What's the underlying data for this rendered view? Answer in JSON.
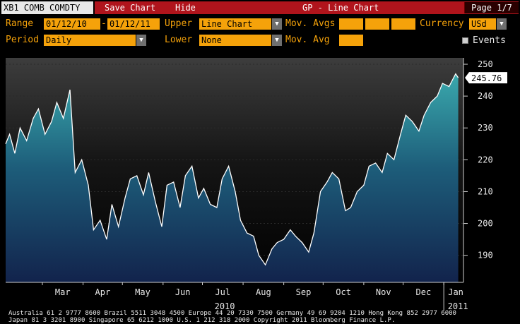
{
  "security": "XB1 COMB COMDTY",
  "toolbar": {
    "save_chart": "Save Chart",
    "hide": "Hide",
    "title": "GP - Line Chart",
    "page": "Page 1/7"
  },
  "controls": {
    "range_label": "Range",
    "range_start": "01/12/10",
    "range_sep": "-",
    "range_end": "01/12/11",
    "upper_label": "Upper",
    "upper_value": "Line Chart",
    "mov_avgs_label": "Mov. Avgs",
    "currency_label": "Currency",
    "currency_value": "USd",
    "period_label": "Period",
    "period_value": "Daily",
    "lower_label": "Lower",
    "lower_value": "None",
    "mov_avg_label": "Mov. Avg",
    "events_label": "Events"
  },
  "colors": {
    "accent": "#f5a20a",
    "bar": "#b0141c",
    "line": "#ffffff"
  },
  "chart_data": {
    "type": "area",
    "title": "",
    "xlabel": "2010",
    "ylabel": "",
    "ylim": [
      181.5,
      252
    ],
    "y_ticks": [
      190,
      200,
      210,
      220,
      230,
      240,
      250
    ],
    "x_month_labels": [
      "Mar",
      "Apr",
      "May",
      "Jun",
      "Jul",
      "Aug",
      "Sep",
      "Oct",
      "Nov",
      "Dec",
      "Jan"
    ],
    "x_year_labels": [
      "2010",
      "2011"
    ],
    "last_value_label": "245.76",
    "series": [
      {
        "x": [
          "2010-02-01",
          "2010-02-04",
          "2010-02-08",
          "2010-02-12",
          "2010-02-17",
          "2010-02-22",
          "2010-02-26",
          "2010-03-03",
          "2010-03-08",
          "2010-03-12",
          "2010-03-17",
          "2010-03-22",
          "2010-03-26",
          "2010-03-31",
          "2010-04-05",
          "2010-04-09",
          "2010-04-14",
          "2010-04-19",
          "2010-04-23",
          "2010-04-28",
          "2010-05-03",
          "2010-05-07",
          "2010-05-12",
          "2010-05-17",
          "2010-05-21",
          "2010-05-26",
          "2010-05-31",
          "2010-06-04",
          "2010-06-09",
          "2010-06-14",
          "2010-06-18",
          "2010-06-23",
          "2010-06-28",
          "2010-07-02",
          "2010-07-07",
          "2010-07-12",
          "2010-07-16",
          "2010-07-21",
          "2010-07-26",
          "2010-07-30",
          "2010-08-04",
          "2010-08-09",
          "2010-08-13",
          "2010-08-18",
          "2010-08-23",
          "2010-08-27",
          "2010-09-01",
          "2010-09-06",
          "2010-09-10",
          "2010-09-15",
          "2010-09-20",
          "2010-09-24",
          "2010-09-29",
          "2010-10-04",
          "2010-10-08",
          "2010-10-13",
          "2010-10-18",
          "2010-10-22",
          "2010-10-27",
          "2010-11-01",
          "2010-11-05",
          "2010-11-10",
          "2010-11-15",
          "2010-11-19",
          "2010-11-24",
          "2010-11-29",
          "2010-12-03",
          "2010-12-08",
          "2010-12-13",
          "2010-12-17",
          "2010-12-22",
          "2010-12-27",
          "2010-12-31",
          "2011-01-05",
          "2011-01-10",
          "2011-01-12"
        ],
        "y": [
          225,
          228,
          222,
          230,
          226,
          233,
          236,
          228,
          232,
          238,
          233,
          242,
          216,
          220,
          212,
          198,
          201,
          195,
          206,
          199,
          208,
          214,
          215,
          209,
          216,
          207,
          199,
          212,
          213,
          205,
          215,
          218,
          208,
          211,
          206,
          205,
          214,
          218,
          210,
          201,
          197,
          196,
          190,
          187,
          192,
          194,
          195,
          198,
          196,
          194,
          191,
          197,
          210,
          213,
          216,
          214,
          204,
          205,
          210,
          212,
          218,
          219,
          216,
          222,
          220,
          228,
          234,
          232,
          229,
          234,
          238,
          240,
          244,
          243,
          247,
          245.76
        ]
      }
    ]
  },
  "footer": {
    "line1": "Australia 61 2 9777 8600 Brazil 5511 3048 4500 Europe 44 20 7330 7500 Germany 49 69 9204 1210 Hong Kong 852 2977 6000",
    "line2": "Japan 81 3 3201 8900          Singapore 65 6212 1000          U.S. 1 212 318 2000          Copyright 2011 Bloomberg Finance L.P."
  }
}
